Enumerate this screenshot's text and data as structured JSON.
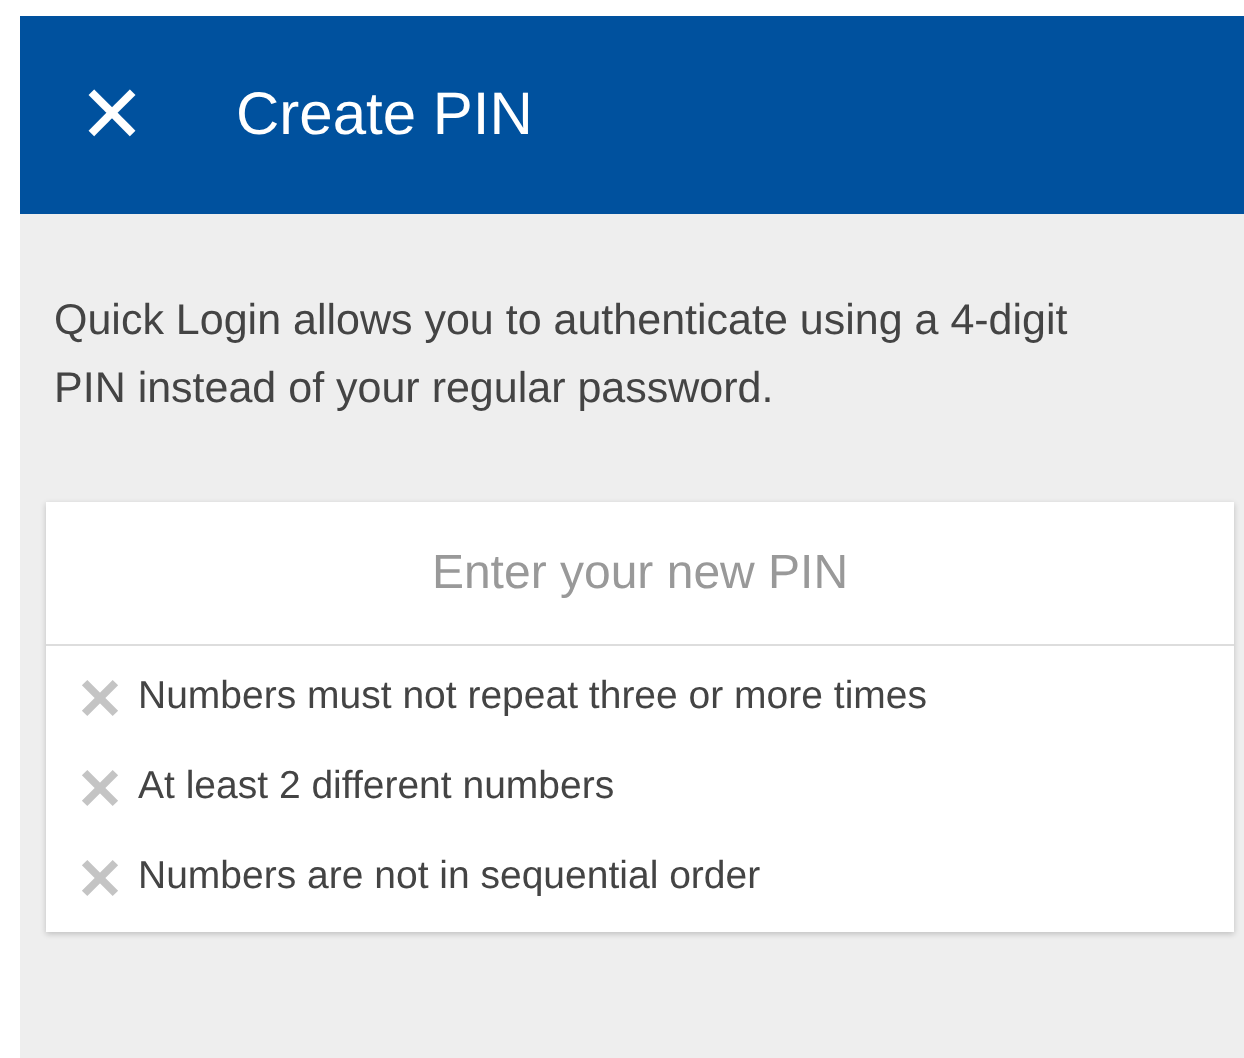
{
  "header": {
    "close_icon": "✕",
    "title": "Create PIN"
  },
  "description": "Quick Login allows you to authenticate using a 4-digit PIN instead of your regular password.",
  "pin_field": {
    "placeholder": "Enter your new PIN"
  },
  "rules": [
    {
      "text": "Numbers must not repeat three or more times",
      "met": false
    },
    {
      "text": "At least 2 different numbers",
      "met": false
    },
    {
      "text": "Numbers are not in sequential order",
      "met": false
    }
  ]
}
